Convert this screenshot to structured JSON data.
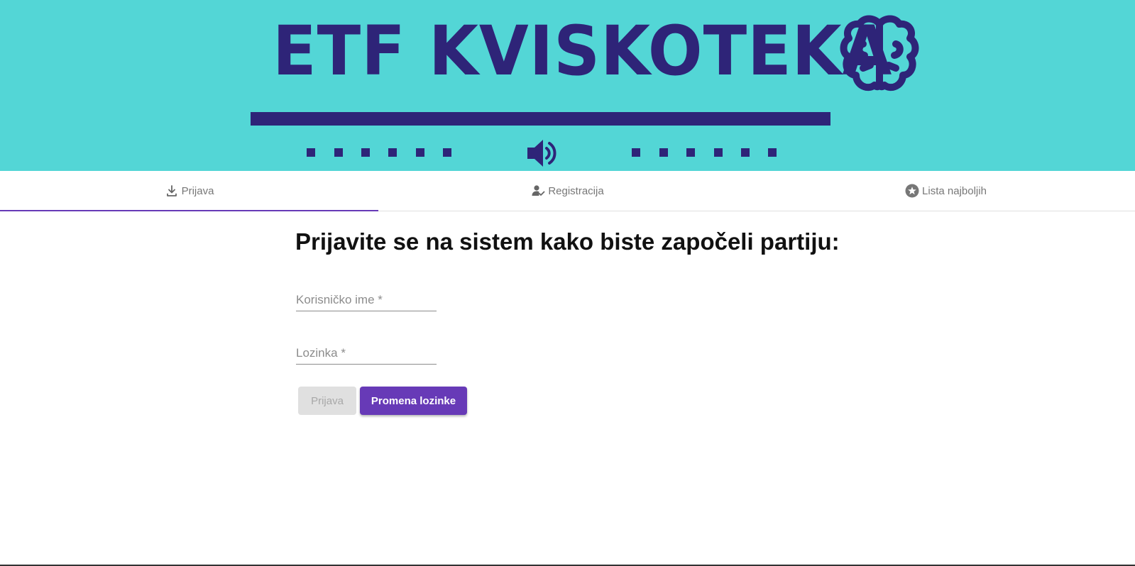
{
  "header": {
    "title": "ETF KVISKOTEKA",
    "brain_icon": "brain-icon",
    "sound_icon": "speaker-icon"
  },
  "tabs": [
    {
      "label": "Prijava",
      "icon": "login-download-icon",
      "active": true
    },
    {
      "label": "Registracija",
      "icon": "person-check-icon",
      "active": false
    },
    {
      "label": "Lista najboljih",
      "icon": "star-circle-icon",
      "active": false
    }
  ],
  "form": {
    "heading": "Prijavite se na sistem kako biste započeli partiju:",
    "username": {
      "value": "",
      "placeholder": "Korisničko ime *"
    },
    "password": {
      "value": "",
      "placeholder": "Lozinka *"
    },
    "login_button": "Prijava",
    "change_password_button": "Promena lozinke"
  },
  "colors": {
    "banner": "#53d6d6",
    "brand_dark": "#2e2478",
    "accent": "#673ab7",
    "disabled_button": "#e0e0e0"
  }
}
